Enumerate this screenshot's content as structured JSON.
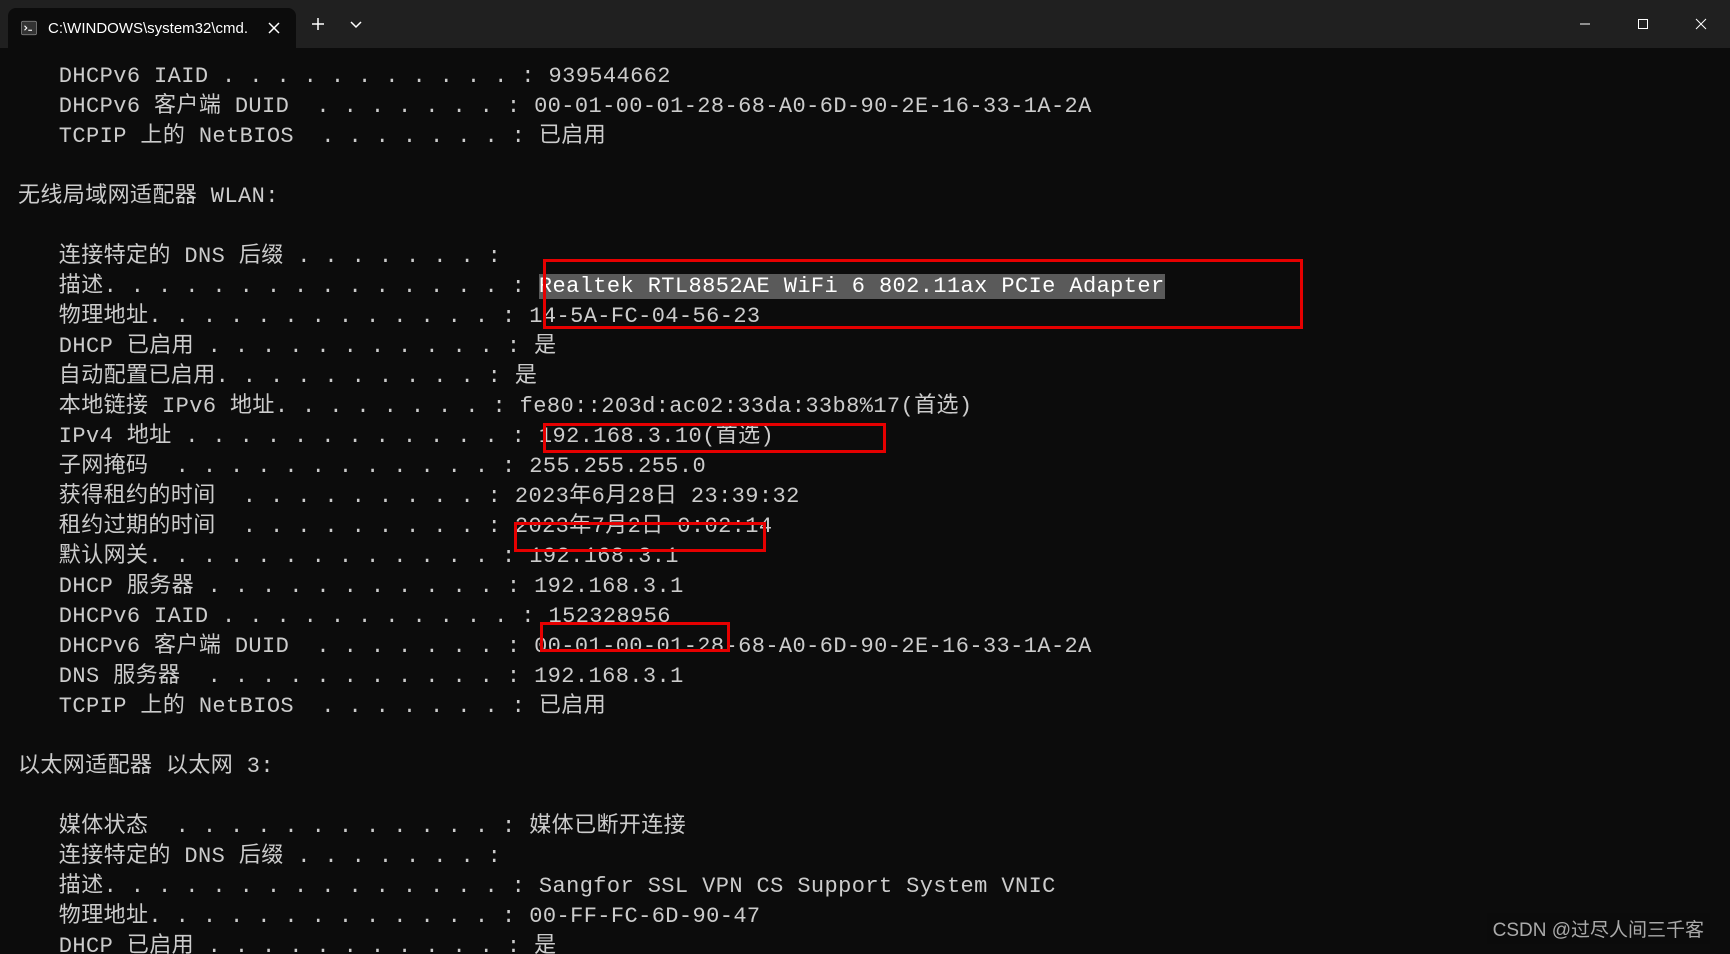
{
  "window": {
    "tab_title": "C:\\WINDOWS\\system32\\cmd."
  },
  "output": {
    "top_block": [
      {
        "label": "   DHCPv6 IAID . . . . . . . . . . . : ",
        "value": "939544662"
      },
      {
        "label": "   DHCPv6 客户端 DUID  . . . . . . . : ",
        "value": "00-01-00-01-28-68-A0-6D-90-2E-16-33-1A-2A"
      },
      {
        "label": "   TCPIP 上的 NetBIOS  . . . . . . . : ",
        "value": "已启用"
      }
    ],
    "wlan_header": "无线局域网适配器 WLAN:",
    "wlan": [
      {
        "label": "   连接特定的 DNS 后缀 . . . . . . . : ",
        "value": ""
      },
      {
        "label": "   描述. . . . . . . . . . . . . . . : ",
        "value": "Realtek RTL8852AE WiFi 6 802.11ax PCIe Adapter",
        "selected": true
      },
      {
        "label": "   物理地址. . . . . . . . . . . . . : ",
        "value": "14-5A-FC-04-56-23"
      },
      {
        "label": "   DHCP 已启用 . . . . . . . . . . . : ",
        "value": "是"
      },
      {
        "label": "   自动配置已启用. . . . . . . . . . : ",
        "value": "是"
      },
      {
        "label": "   本地链接 IPv6 地址. . . . . . . . : ",
        "value": "fe80::203d:ac02:33da:33b8%17(首选)"
      },
      {
        "label": "   IPv4 地址 . . . . . . . . . . . . : ",
        "value": "192.168.3.10(首选)"
      },
      {
        "label": "   子网掩码  . . . . . . . . . . . . : ",
        "value": "255.255.255.0"
      },
      {
        "label": "   获得租约的时间  . . . . . . . . . : ",
        "value": "2023年6月28日 23:39:32"
      },
      {
        "label": "   租约过期的时间  . . . . . . . . . : ",
        "value": "2023年7月2日 0:02:14"
      },
      {
        "label": "   默认网关. . . . . . . . . . . . . : ",
        "value": "192.168.3.1"
      },
      {
        "label": "   DHCP 服务器 . . . . . . . . . . . : ",
        "value": "192.168.3.1"
      },
      {
        "label": "   DHCPv6 IAID . . . . . . . . . . . : ",
        "value": "152328956"
      },
      {
        "label": "   DHCPv6 客户端 DUID  . . . . . . . : ",
        "value": "00-01-00-01-28-68-A0-6D-90-2E-16-33-1A-2A"
      },
      {
        "label": "   DNS 服务器  . . . . . . . . . . . : ",
        "value": "192.168.3.1"
      },
      {
        "label": "   TCPIP 上的 NetBIOS  . . . . . . . : ",
        "value": "已启用"
      }
    ],
    "eth3_header": "以太网适配器 以太网 3:",
    "eth3": [
      {
        "label": "   媒体状态  . . . . . . . . . . . . : ",
        "value": "媒体已断开连接"
      },
      {
        "label": "   连接特定的 DNS 后缀 . . . . . . . : ",
        "value": ""
      },
      {
        "label": "   描述. . . . . . . . . . . . . . . : ",
        "value": "Sangfor SSL VPN CS Support System VNIC"
      },
      {
        "label": "   物理地址. . . . . . . . . . . . . : ",
        "value": "00-FF-FC-6D-90-47"
      },
      {
        "label": "   DHCP 已启用 . . . . . . . . . . . : ",
        "value": "是"
      }
    ]
  },
  "watermark": "CSDN @过尽人间三千客"
}
